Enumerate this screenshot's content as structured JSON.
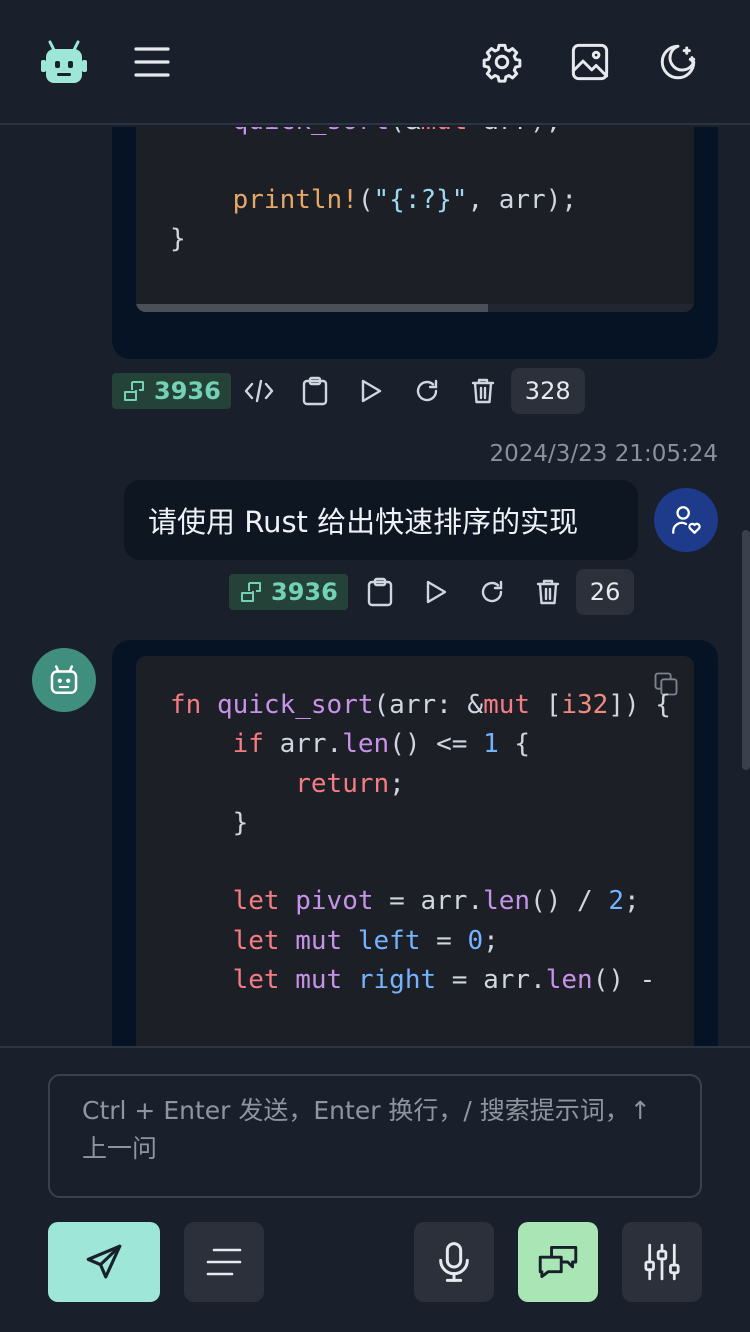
{
  "colors": {
    "background": "#1a202b",
    "accent_teal": "#9ee6d8",
    "accent_green": "#a9e5b5",
    "token_text": "#73d1b5",
    "user_avatar": "#1e3a8a",
    "bot_avatar": "#3f8e7e"
  },
  "header": {
    "icons": [
      "robot-logo-icon",
      "menu-icon",
      "gear-icon",
      "image-icon",
      "moon-icon"
    ]
  },
  "messages": [
    {
      "role": "assistant",
      "code_visible": true,
      "actions": {
        "tokens": "3936",
        "count": "328"
      }
    },
    {
      "role": "user",
      "timestamp": "2024/3/23 21:05:24",
      "text": "请使用 Rust 给出快速排序的实现",
      "actions": {
        "tokens": "3936",
        "count": "26"
      }
    },
    {
      "role": "assistant",
      "code_visible": true
    }
  ],
  "input": {
    "placeholder": "Ctrl + Enter 发送，Enter 换行，/ 搜索提示词，↑ 上一问"
  },
  "footer": {
    "buttons": [
      "send-icon",
      "prompt-list-icon",
      "microphone-icon",
      "chat-mode-icon",
      "settings-sliders-icon"
    ]
  }
}
